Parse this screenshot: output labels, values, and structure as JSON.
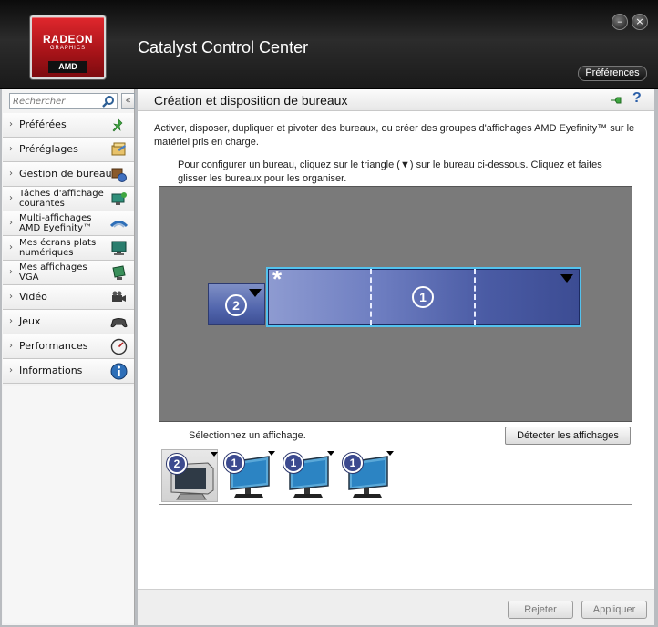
{
  "header": {
    "logo_brand": "RADEON",
    "logo_sub": "GRAPHICS",
    "logo_maker": "AMD",
    "app_title": "Catalyst Control Center",
    "preferences_label": "Préférences",
    "minimize_glyph": "–",
    "close_glyph": "×"
  },
  "sidebar": {
    "search_placeholder": "Rechercher",
    "collapse_glyph": "«",
    "items": [
      {
        "label": "Préférées",
        "icon": "pin-icon"
      },
      {
        "label": "Préréglages",
        "icon": "presets-icon"
      },
      {
        "label": "Gestion de bureau",
        "icon": "desktop-management-icon"
      },
      {
        "label_line1": "Tâches d'affichage",
        "label_line2": "courantes",
        "icon": "display-tasks-icon"
      },
      {
        "label_line1": "Multi-affichages",
        "label_line2": "AMD Eyefinity™",
        "icon": "eyefinity-icon"
      },
      {
        "label_line1": "Mes écrans plats",
        "label_line2": "numériques",
        "icon": "flat-panel-icon"
      },
      {
        "label_line1": "Mes affichages",
        "label_line2": "VGA",
        "icon": "vga-display-icon"
      },
      {
        "label": "Vidéo",
        "icon": "video-camera-icon"
      },
      {
        "label": "Jeux",
        "icon": "gamepad-icon"
      },
      {
        "label": "Performances",
        "icon": "gauge-icon"
      },
      {
        "label": "Informations",
        "icon": "info-icon"
      }
    ]
  },
  "main": {
    "title": "Création et disposition de bureaux",
    "help_glyph": "?",
    "description": "Activer, disposer, dupliquer et pivoter des bureaux, ou créer des groupes d'affichages AMD Eyefinity™ sur le matériel pris en charge.",
    "instructions": "Pour configurer un bureau, cliquez sur le triangle (▼) sur le bureau ci-dessous.  Cliquez et faites glisser les bureaux pour les organiser.",
    "desktops": [
      {
        "number": "2",
        "primary": false
      },
      {
        "number": "1",
        "primary": true,
        "marker": "*",
        "group_size": 3
      }
    ],
    "select_display_label": "Sélectionnez un affichage.",
    "detect_button": "Détecter les affichages",
    "displays": [
      {
        "number": "2",
        "type": "crt",
        "selected": true
      },
      {
        "number": "1",
        "type": "lcd",
        "selected": false
      },
      {
        "number": "1",
        "type": "lcd",
        "selected": false
      },
      {
        "number": "1",
        "type": "lcd",
        "selected": false
      }
    ]
  },
  "footer": {
    "reject_label": "Rejeter",
    "apply_label": "Appliquer"
  },
  "colors": {
    "desktop_blue": "#4a5ba4",
    "selection_border": "#53c2ee",
    "canvas_gray": "#7a7a7a",
    "brand_red": "#c4171d"
  }
}
